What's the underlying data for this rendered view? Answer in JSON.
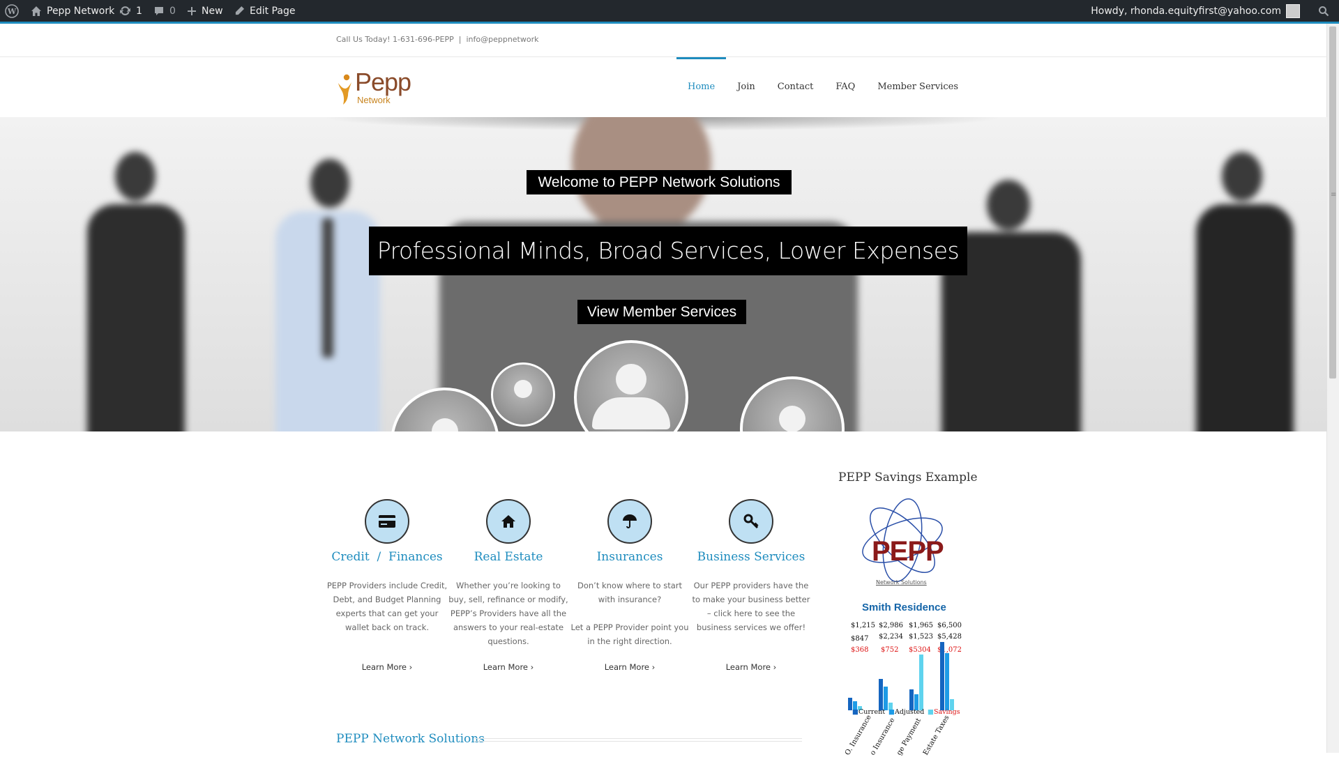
{
  "admin_bar": {
    "site_name": "Pepp Network",
    "updates_count": "1",
    "comments_count": "0",
    "new_label": "New",
    "edit_label": "Edit Page",
    "howdy": "Howdy, rhonda.equityfirst@yahoo.com"
  },
  "topbar": {
    "contact": "Call Us Today! 1-631-696-PEPP  |  info@peppnetwork"
  },
  "logo": {
    "name": "Pepp",
    "sub": "Network"
  },
  "nav": {
    "items": [
      {
        "label": "Home",
        "active": true
      },
      {
        "label": "Join",
        "active": false
      },
      {
        "label": "Contact",
        "active": false
      },
      {
        "label": "FAQ",
        "active": false
      },
      {
        "label": "Member Services",
        "active": false
      }
    ]
  },
  "hero": {
    "caption1": "Welcome to PEPP Network Solutions",
    "caption2": "Professional Minds, Broad Services, Lower Expenses",
    "button": "View Member Services"
  },
  "services": [
    {
      "icon": "credit-card-icon",
      "title": "Credit  /  Finances",
      "desc": "PEPP Providers include Credit, Debt, and Budget Planning experts that can get your wallet back on track.",
      "more": "Learn More"
    },
    {
      "icon": "home-icon",
      "title": "Real Estate",
      "desc": "Whether you’re looking to buy, sell, refinance or modify, PEPP’s Providers have all the answers to your real-estate questions.",
      "more": "Learn More"
    },
    {
      "icon": "umbrella-icon",
      "title": "Insurances",
      "desc": "Don’t know where to start with insurance?\n\nLet a PEPP Provider point you in the right direction.",
      "more": "Learn More"
    },
    {
      "icon": "key-icon",
      "title": "Business Services",
      "desc": "Our PEPP providers have the to make your business better – click here to see the business services we offer!",
      "more": "Learn More"
    }
  ],
  "section": {
    "title": "PEPP Network Solutions"
  },
  "sidebar": {
    "title": "PEPP Savings Example",
    "image": {
      "logo_text": "PEPP",
      "logo_sub": "Network Solutions",
      "heading": "Smith Residence",
      "current": [
        "$1,215",
        "$2,986",
        "$1,965",
        "$6,500"
      ],
      "adjusted": [
        "$847",
        "$2,234",
        "$1,523",
        "$5,428"
      ],
      "savings": [
        "$368",
        "$752",
        "$5304",
        "$1,072"
      ],
      "legend": [
        "Current",
        "Adjusted",
        "Savings"
      ],
      "x_labels": [
        "O. Insurance",
        "o Insurance",
        "ge Payment",
        "Estate Taxes"
      ],
      "colors": {
        "current": "#1565c0",
        "adjusted": "#1e9be6",
        "savings": "#5fd3ee",
        "savings_text": "#d11111"
      }
    }
  },
  "colors": {
    "accent": "#1e8cbe",
    "admin_bar": "#23282d",
    "icon_circle": "#bfe0f3"
  }
}
